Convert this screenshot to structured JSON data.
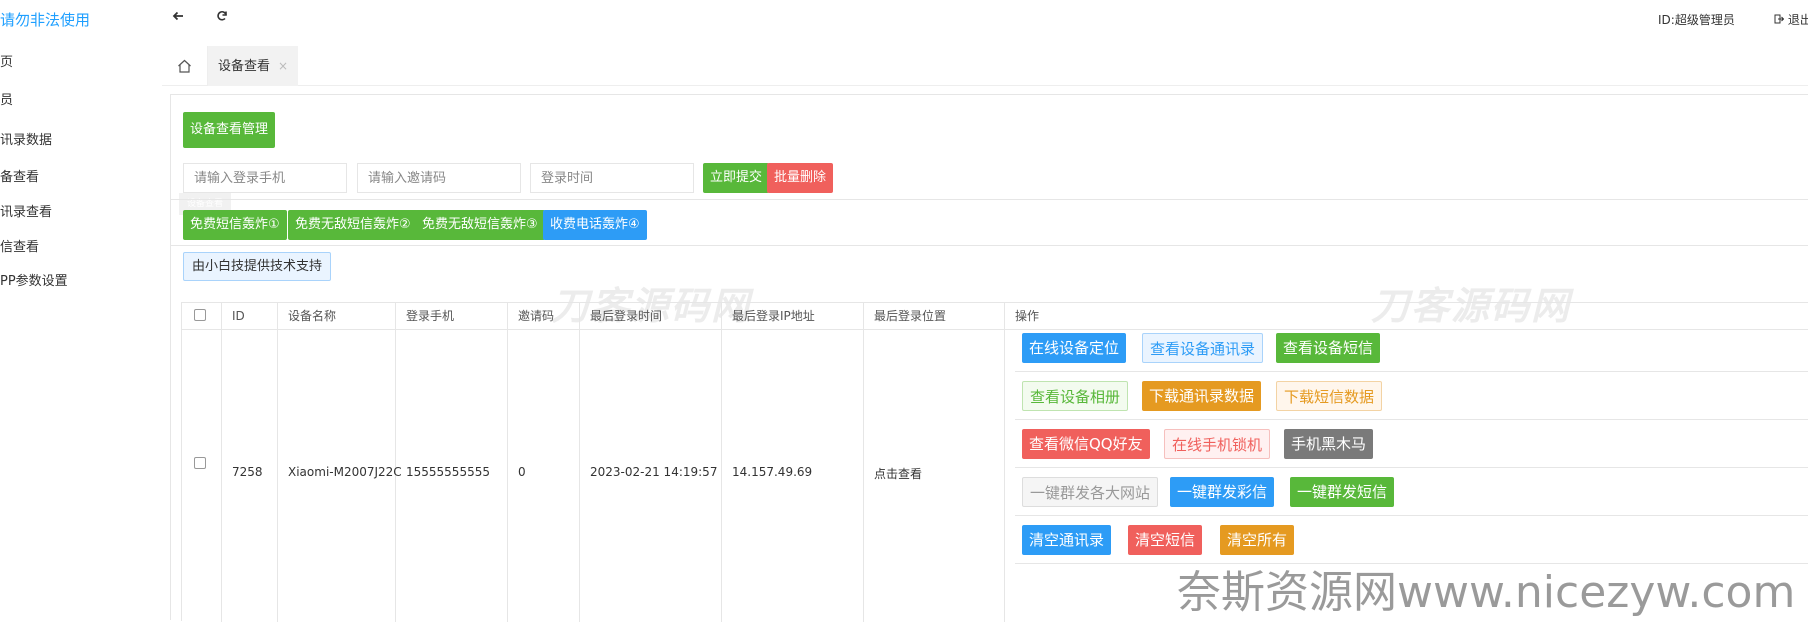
{
  "header": {
    "brand": "请勿非法使用",
    "back_icon": "arrow-left-icon",
    "refresh_icon": "refresh-icon",
    "user_id": "ID:超级管理员",
    "logout": "退出"
  },
  "sidebar": {
    "items": [
      {
        "label": "页"
      },
      {
        "label": "员"
      },
      {
        "label": "讯录数据"
      },
      {
        "label": "备查看"
      },
      {
        "label": "讯录查看"
      },
      {
        "label": "信查看"
      },
      {
        "label": "PP参数设置"
      }
    ]
  },
  "tabs": {
    "home_icon": "home-icon",
    "active": "设备查看",
    "close": "×"
  },
  "toolbar": {
    "title": "设备查看管理",
    "phone_placeholder": "请输入登录手机",
    "invite_placeholder": "请输入邀请码",
    "time_placeholder": "登录时间",
    "submit": "立即提交",
    "batch_delete": "批量删除",
    "ghost_tip": "设备查看"
  },
  "bomb_buttons": [
    "免费短信轰炸①",
    "免费无敌短信轰炸②",
    "免费无敌短信轰炸③",
    "收费电话轰炸④"
  ],
  "support": "由小白技提供技术支持",
  "watermark": "刀客源码网",
  "site_mark": "奈斯资源网www.nicezyw.com",
  "table": {
    "headers": [
      "ID",
      "设备名称",
      "登录手机",
      "邀请码",
      "最后登录时间",
      "最后登录IP地址",
      "最后登录位置",
      "操作"
    ],
    "row": {
      "id": "7258",
      "device": "Xiaomi-M2007J22C",
      "phone": "15555555555",
      "invite": "0",
      "last_time": "2023-02-21 14:19:57",
      "last_ip": "14.157.49.69",
      "last_loc": "点击查看"
    },
    "ops": [
      [
        "在线设备定位",
        "查看设备通讯录",
        "查看设备短信"
      ],
      [
        "查看设备相册",
        "下载通讯录数据",
        "下载短信数据"
      ],
      [
        "查看微信QQ好友",
        "在线手机锁机",
        "手机黑木马"
      ],
      [
        "一键群发各大网站",
        "一键群发彩信",
        "一键群发短信"
      ],
      [
        "清空通讯录",
        "清空短信",
        "清空所有"
      ]
    ]
  },
  "colors": {
    "green": "#58b83a",
    "red": "#f0605c",
    "blue": "#2d9cf6",
    "orange": "#e59a21",
    "gray": "#7a7a7a",
    "brand": "#1E9FFF"
  }
}
